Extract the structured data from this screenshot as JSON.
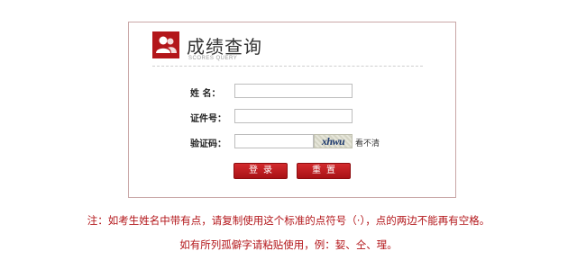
{
  "header": {
    "title": "成绩查询",
    "subtitle": "SCORES QUERY",
    "icon": "users-icon"
  },
  "form": {
    "name_label": "姓  名：",
    "id_label": "证件号：",
    "captcha_label": "验证码：",
    "name_value": "",
    "id_value": "",
    "captcha_value": "",
    "captcha_text": "xhwu",
    "refresh_label": "看不清",
    "login_label": "登录",
    "reset_label": "重置"
  },
  "notes": {
    "line1": "注：如考生姓名中带有点，请复制使用这个标准的点符号（·），点的两边不能再有空格。",
    "line2": "如有所列孤僻字请粘贴使用，例：㛃、仝、瑆。"
  },
  "colors": {
    "accent": "#b3161a",
    "border": "#c9a7a7"
  }
}
